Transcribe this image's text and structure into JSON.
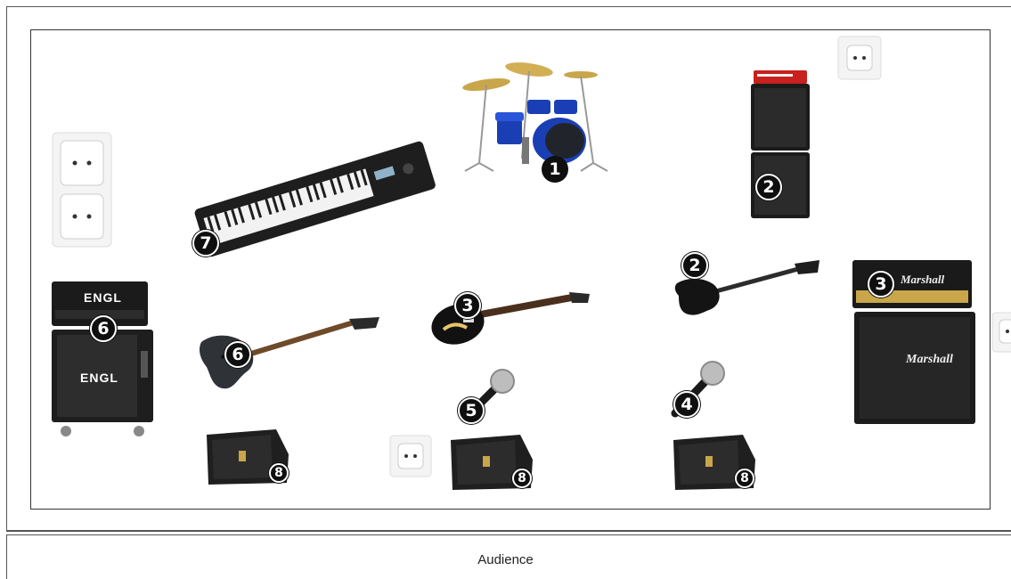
{
  "labels": {
    "audience": "Audience"
  },
  "markers": {
    "drums": "1",
    "bass_cab": "2",
    "bass_guitar": "2",
    "guitar_les_paul": "3",
    "marshall_head": "3",
    "mic_right": "4",
    "mic_center": "5",
    "engl_head": "6",
    "guitar_left": "6",
    "keyboard": "7",
    "monitor_left": "8",
    "monitor_center": "8",
    "monitor_right": "8"
  },
  "logos": {
    "engl": "ENGL",
    "marshall": "Marshall"
  },
  "colors": {
    "drum_shell": "#1a3fb5",
    "marker": "#0f0f0f",
    "cabinet": "#1b1b1b",
    "amp_red": "#c8201e"
  }
}
